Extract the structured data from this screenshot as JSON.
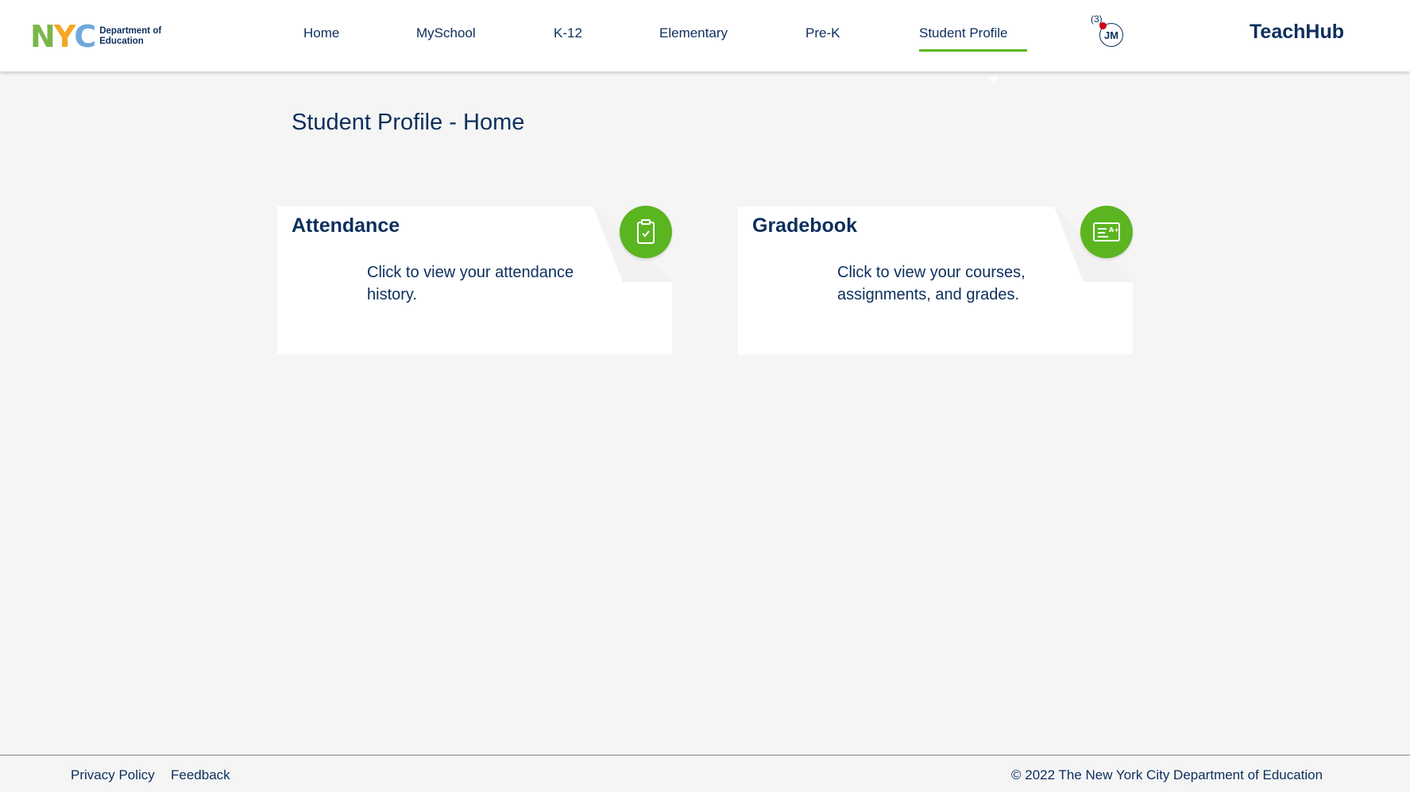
{
  "header": {
    "logo": {
      "letters": [
        "N",
        "Y",
        "C"
      ],
      "letter_colors": [
        "#7ab648",
        "#f5a623",
        "#6fa8dc"
      ],
      "line1": "Department of",
      "line2": "Education"
    },
    "nav": [
      {
        "label": "Home",
        "active": false
      },
      {
        "label": "MySchool",
        "active": false
      },
      {
        "label": "K-12",
        "active": false
      },
      {
        "label": "Elementary",
        "active": false
      },
      {
        "label": "Pre-K",
        "active": false
      },
      {
        "label": "Student Profile",
        "active": true
      }
    ],
    "user": {
      "notification_count": "(3)",
      "initials": "JM"
    },
    "brand": "TeachHub"
  },
  "main": {
    "title": "Student Profile - Home",
    "cards": [
      {
        "title": "Attendance",
        "description_line1": "Click to view your attendance",
        "description_line2": "history.",
        "icon": "clipboard-check-icon"
      },
      {
        "title": "Gradebook",
        "description_line1": "Click to view your courses,",
        "description_line2": "assignments, and grades.",
        "icon": "gradebook-icon"
      }
    ]
  },
  "footer": {
    "privacy": "Privacy Policy",
    "feedback": "Feedback",
    "copyright": "© 2022 The New York City Department of Education"
  },
  "colors": {
    "accent_green": "#5bb520",
    "navy": "#0c2f5c",
    "background": "#f5f5f5",
    "notification_red": "#d0021b"
  }
}
